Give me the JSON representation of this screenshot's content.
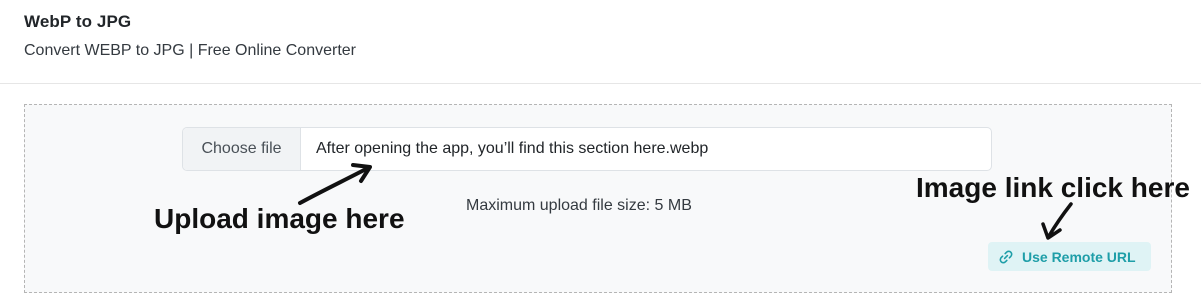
{
  "header": {
    "title": "WebP to JPG",
    "subtitle": "Convert WEBP to JPG | Free Online Converter"
  },
  "upload": {
    "choose_label": "Choose file",
    "file_name": "After opening the app, you’ll find this section here.webp",
    "max_size_text": "Maximum upload file size: 5 MB"
  },
  "remote": {
    "label": "Use Remote URL",
    "icon": "link-icon"
  },
  "annotations": {
    "upload_hint": "Upload image here",
    "link_hint": "Image link click here"
  },
  "colors": {
    "accent": "#1e9ea8",
    "accent_bg": "#dff3f5",
    "dropzone_bg": "#f8f9fa"
  }
}
